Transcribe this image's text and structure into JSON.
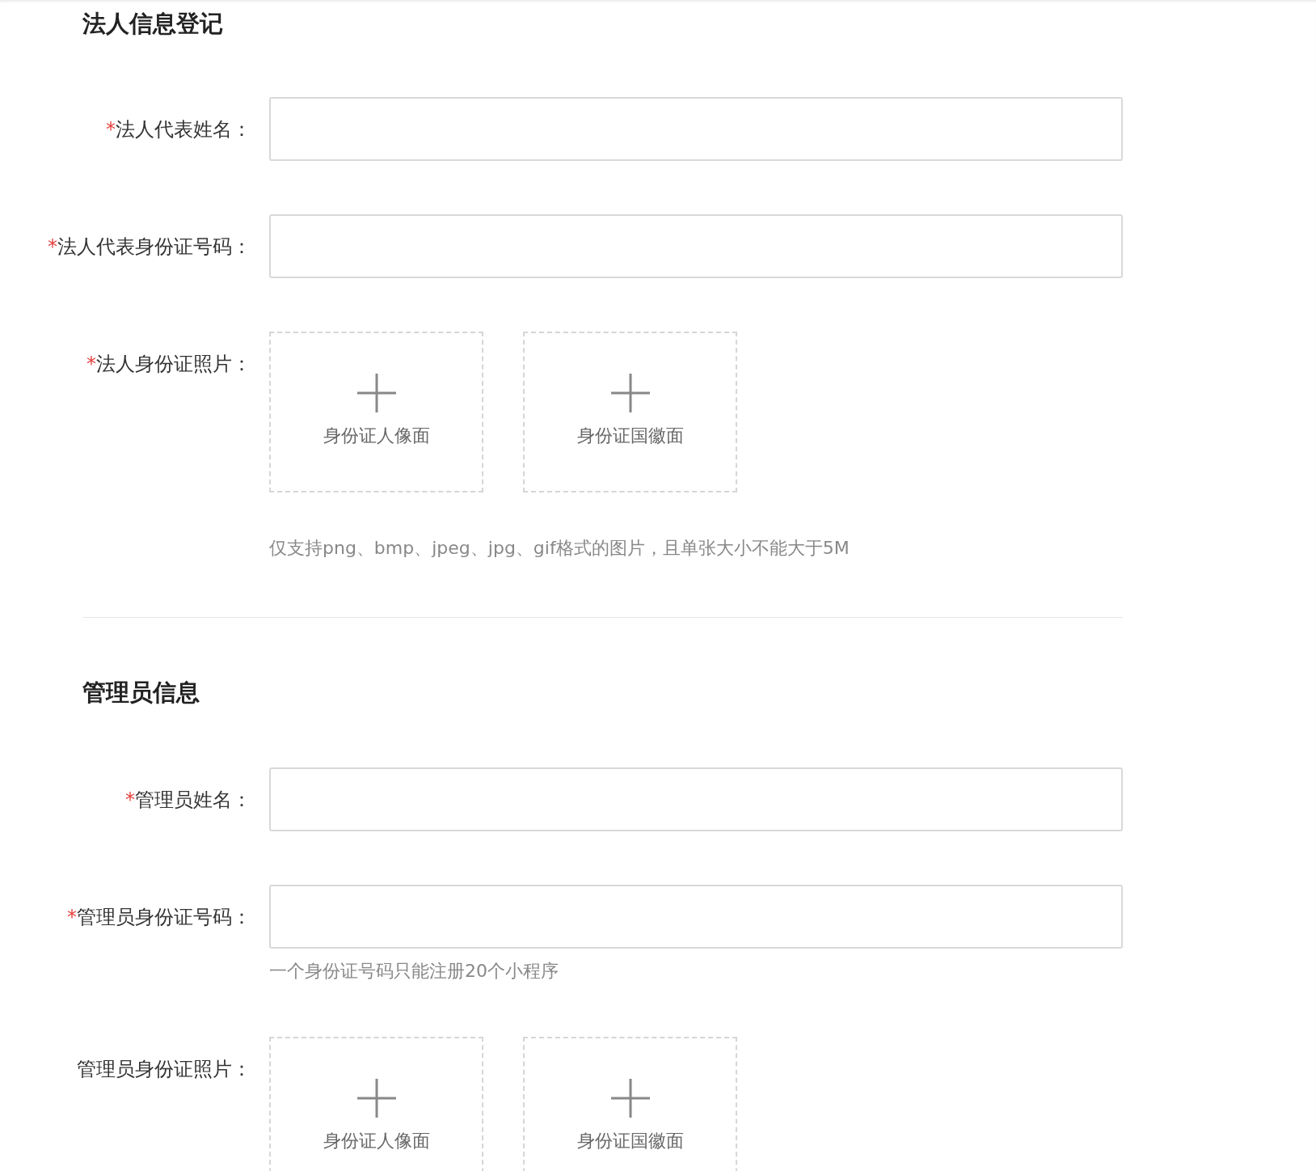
{
  "sections": [
    {
      "title": "法人信息登记",
      "fields": [
        {
          "kind": "text",
          "mark": "*",
          "label": "法人代表姓名："
        },
        {
          "kind": "text",
          "mark": "*",
          "label": "法人代表身份证号码："
        },
        {
          "kind": "upload",
          "mark": "*",
          "label": "法人身份证照片：",
          "slots": [
            {
              "label": "身份证人像面"
            },
            {
              "label": "身份证国徽面"
            }
          ],
          "hint": "仅支持png、bmp、jpeg、jpg、gif格式的图片，且单张大小不能大于5M"
        }
      ]
    },
    {
      "title": "管理员信息",
      "fields": [
        {
          "kind": "text",
          "mark": "*",
          "label": "管理员姓名："
        },
        {
          "kind": "text",
          "mark": "*",
          "label": "管理员身份证号码：",
          "hint": "一个身份证号码只能注册20个小程序"
        },
        {
          "kind": "upload",
          "label": "管理员身份证照片：",
          "slots": [
            {
              "label": "身份证人像面"
            },
            {
              "label": "身份证国徽面"
            }
          ]
        }
      ]
    }
  ]
}
